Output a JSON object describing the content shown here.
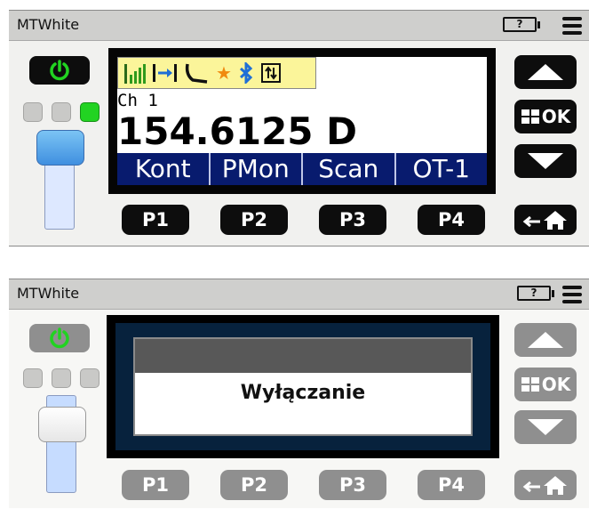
{
  "colors": {
    "dark_button": "#0d0d0d",
    "dim_button": "#8f8f8f",
    "power_green": "#21d321",
    "softkey_bar": "#081b6e",
    "status_bar": "#fbf59a",
    "popup_frame": "#07223d"
  },
  "panels": [
    {
      "title": "MTWhite",
      "battery": "?",
      "status_icons": [
        "signal-icon",
        "arrow-bar-icon",
        "handset-icon",
        "star-icon",
        "bluetooth-icon",
        "transfer-icon"
      ],
      "channel": "Ch 1",
      "frequency": "154.6125 D",
      "softkeys": [
        "Kont",
        "PMon",
        "Scan",
        "OT-1"
      ],
      "ok_label": "OK",
      "pbuttons": [
        "P1",
        "P2",
        "P3",
        "P4"
      ]
    },
    {
      "title": "MTWhite",
      "battery": "?",
      "popup_message": "Wyłączanie",
      "ok_label": "OK",
      "pbuttons": [
        "P1",
        "P2",
        "P3",
        "P4"
      ]
    }
  ]
}
